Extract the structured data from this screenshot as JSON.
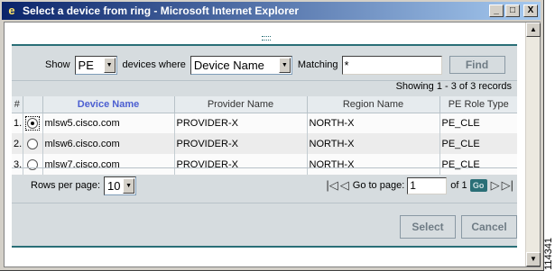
{
  "window": {
    "title": "Select a device from ring - Microsoft Internet Explorer",
    "controls": [
      "_",
      "□",
      "X"
    ]
  },
  "filter": {
    "show_label": "Show",
    "show_value": "PE",
    "devices_where_label": "devices where",
    "field_value": "Device Name",
    "matching_label": "Matching",
    "matching_value": "*",
    "find_label": "Find"
  },
  "records_text": "Showing 1 - 3 of 3 records",
  "table": {
    "headers": [
      "#",
      "",
      "Device Name",
      "Provider Name",
      "Region Name",
      "PE Role Type"
    ],
    "rows": [
      {
        "num": "1.",
        "selected": true,
        "device": "mlsw5.cisco.com",
        "provider": "PROVIDER-X",
        "region": "NORTH-X",
        "role": "PE_CLE"
      },
      {
        "num": "2.",
        "selected": false,
        "device": "mlsw6.cisco.com",
        "provider": "PROVIDER-X",
        "region": "NORTH-X",
        "role": "PE_CLE"
      },
      {
        "num": "3.",
        "selected": false,
        "device": "mlsw7.cisco.com",
        "provider": "PROVIDER-X",
        "region": "NORTH-X",
        "role": "PE_CLE"
      }
    ]
  },
  "pager": {
    "rows_label": "Rows per page:",
    "rows_value": "10",
    "goto_label": "Go to page:",
    "page_value": "1",
    "of_label": "of 1",
    "go_label": "Go"
  },
  "actions": {
    "select_label": "Select",
    "cancel_label": "Cancel"
  },
  "side_number": "114341"
}
